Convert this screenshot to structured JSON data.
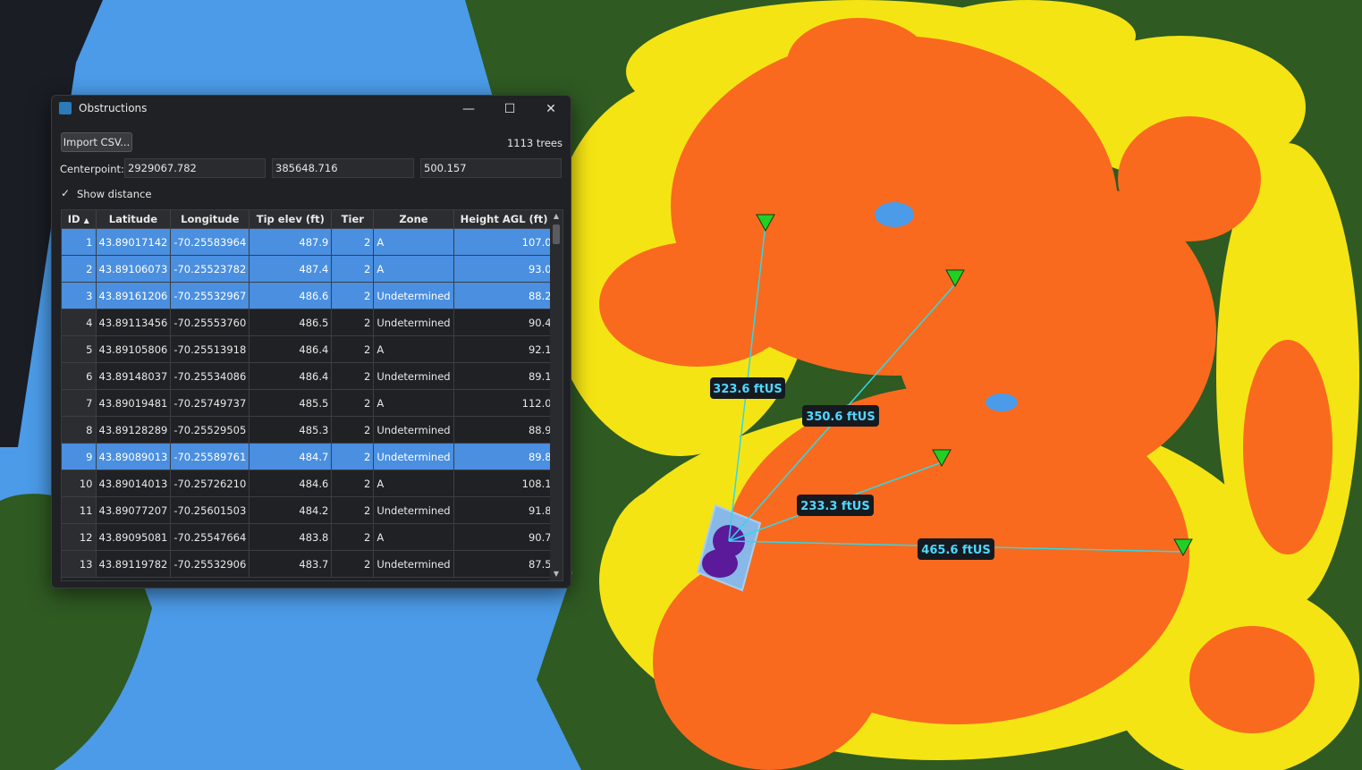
{
  "window": {
    "title": "Obstructions",
    "accent": "#4a8fe0"
  },
  "toolbar": {
    "import_label": "Import CSV...",
    "tree_count": "1113 trees"
  },
  "centerpoint": {
    "label": "Centerpoint:",
    "x": "2929067.782",
    "y": "385648.716",
    "z": "500.157"
  },
  "show_distance": {
    "label": "Show distance",
    "checked": true
  },
  "table": {
    "columns": [
      "ID",
      "Latitude",
      "Longitude",
      "Tip elev (ft)",
      "Tier",
      "Zone",
      "Height AGL (ft)"
    ],
    "rows": [
      {
        "id": "1",
        "lat": "43.89017142",
        "lon": "-70.25583964",
        "tip": "487.9",
        "tier": "2",
        "zone": "A",
        "agl": "107.0",
        "selected": true
      },
      {
        "id": "2",
        "lat": "43.89106073",
        "lon": "-70.25523782",
        "tip": "487.4",
        "tier": "2",
        "zone": "A",
        "agl": "93.0",
        "selected": true
      },
      {
        "id": "3",
        "lat": "43.89161206",
        "lon": "-70.25532967",
        "tip": "486.6",
        "tier": "2",
        "zone": "Undetermined",
        "agl": "88.2",
        "selected": true
      },
      {
        "id": "4",
        "lat": "43.89113456",
        "lon": "-70.25553760",
        "tip": "486.5",
        "tier": "2",
        "zone": "Undetermined",
        "agl": "90.4",
        "selected": false
      },
      {
        "id": "5",
        "lat": "43.89105806",
        "lon": "-70.25513918",
        "tip": "486.4",
        "tier": "2",
        "zone": "A",
        "agl": "92.1",
        "selected": false
      },
      {
        "id": "6",
        "lat": "43.89148037",
        "lon": "-70.25534086",
        "tip": "486.4",
        "tier": "2",
        "zone": "Undetermined",
        "agl": "89.1",
        "selected": false
      },
      {
        "id": "7",
        "lat": "43.89019481",
        "lon": "-70.25749737",
        "tip": "485.5",
        "tier": "2",
        "zone": "A",
        "agl": "112.0",
        "selected": false
      },
      {
        "id": "8",
        "lat": "43.89128289",
        "lon": "-70.25529505",
        "tip": "485.3",
        "tier": "2",
        "zone": "Undetermined",
        "agl": "88.9",
        "selected": false
      },
      {
        "id": "9",
        "lat": "43.89089013",
        "lon": "-70.25589761",
        "tip": "484.7",
        "tier": "2",
        "zone": "Undetermined",
        "agl": "89.8",
        "selected": true
      },
      {
        "id": "10",
        "lat": "43.89014013",
        "lon": "-70.25726210",
        "tip": "484.6",
        "tier": "2",
        "zone": "A",
        "agl": "108.1",
        "selected": false
      },
      {
        "id": "11",
        "lat": "43.89077207",
        "lon": "-70.25601503",
        "tip": "484.2",
        "tier": "2",
        "zone": "Undetermined",
        "agl": "91.8",
        "selected": false
      },
      {
        "id": "12",
        "lat": "43.89095081",
        "lon": "-70.25547664",
        "tip": "483.8",
        "tier": "2",
        "zone": "A",
        "agl": "90.7",
        "selected": false
      },
      {
        "id": "13",
        "lat": "43.89119782",
        "lon": "-70.25532906",
        "tip": "483.7",
        "tier": "2",
        "zone": "Undetermined",
        "agl": "87.5",
        "selected": false
      }
    ]
  },
  "map": {
    "labels": [
      "323.6 ftUS",
      "350.6 ftUS",
      "233.3 ftUS",
      "465.6 ftUS"
    ],
    "colors": {
      "water": "#4b9be8",
      "forest": "#2f5a22",
      "yellow": "#f5e414",
      "orange": "#f96a1e",
      "marker": "#22d022",
      "label_text": "#4fd8ff"
    }
  }
}
